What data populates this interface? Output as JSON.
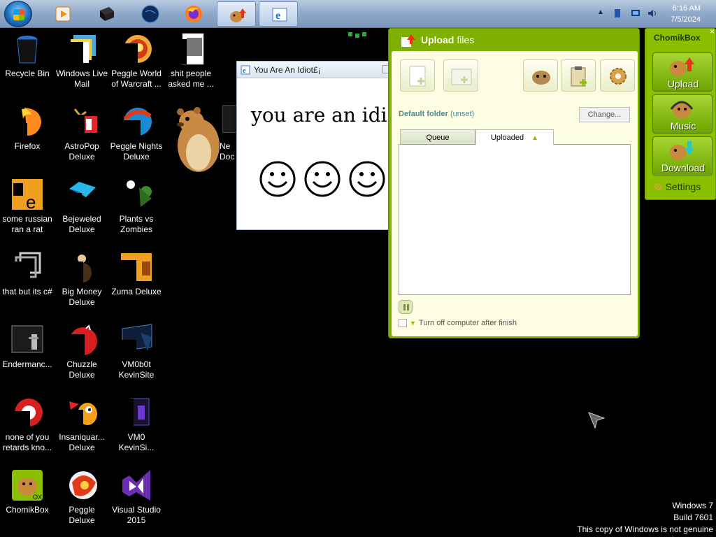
{
  "taskbar": {
    "start": "start-orb",
    "pinned": [
      "media-player-icon",
      "dark-app-icon",
      "globe-icon",
      "firefox-icon",
      "chomikbox-icon",
      "internet-explorer-icon"
    ],
    "clock": {
      "time": "6:16 AM",
      "date": "7/5/2024"
    }
  },
  "desktop_icons": [
    {
      "label": "Recycle Bin",
      "icon": "recycle-bin-icon"
    },
    {
      "label": "Windows Live Mail",
      "icon": "mail-icon"
    },
    {
      "label": "Peggle World of Warcraft ...",
      "icon": "peggle-icon"
    },
    {
      "label": "shit people asked me ...",
      "icon": "folder-icon"
    },
    {
      "label": "Firefox",
      "icon": "firefox-icon"
    },
    {
      "label": "AstroPop Deluxe",
      "icon": "astropop-icon"
    },
    {
      "label": "Peggle Nights Deluxe",
      "icon": "peggle-nights-icon"
    },
    {
      "label": "some russian ran a rat",
      "icon": "document-icon"
    },
    {
      "label": "Bejeweled Deluxe",
      "icon": "bejeweled-icon"
    },
    {
      "label": "Plants vs Zombies",
      "icon": "pvz-icon"
    },
    {
      "label": "that but its c#",
      "icon": "shortcut-icon"
    },
    {
      "label": "Big Money Deluxe",
      "icon": "big-money-icon"
    },
    {
      "label": "Zuma Deluxe",
      "icon": "zuma-icon"
    },
    {
      "label": "Endermanc...",
      "icon": "console-icon"
    },
    {
      "label": "Chuzzle Deluxe",
      "icon": "chuzzle-icon"
    },
    {
      "label": "VM0b0t KevinSite",
      "icon": "vm-icon"
    },
    {
      "label": "none of you retards kno...",
      "icon": "red-app-icon"
    },
    {
      "label": "Insaniquar... Deluxe",
      "icon": "insaniquarium-icon"
    },
    {
      "label": "VM0 KevinSi...",
      "icon": "vm-file-icon"
    },
    {
      "label": "ChomikBox",
      "icon": "chomikbox-app-icon"
    },
    {
      "label": "Peggle Deluxe",
      "icon": "peggle-deluxe-icon"
    },
    {
      "label": "Visual Studio 2015",
      "icon": "visual-studio-icon"
    }
  ],
  "partial_icon_label": "Ne\nDoc",
  "idiot_window": {
    "title": "You Are An Idiot£¡",
    "body_text": "you are an idiot",
    "smileys": [
      "☺",
      "☺",
      "☺"
    ]
  },
  "upload_panel": {
    "title_bold": "Upload",
    "title_rest": " files",
    "default_folder_label": "Default folder",
    "default_folder_value": "(unset)",
    "change_button": "Change...",
    "tabs": [
      "Queue",
      "Uploaded"
    ],
    "active_tab": "Uploaded",
    "turn_off_label": "Turn off computer after finish"
  },
  "chomikbox_menu": {
    "title": "ChomikBox",
    "buttons": [
      "Upload",
      "Music",
      "Download"
    ],
    "settings": "Settings"
  },
  "watermark": {
    "line1": "Windows 7",
    "line2": "Build 7601",
    "line3": "This copy of Windows is not genuine"
  },
  "colors": {
    "chomik_green": "#7fb000",
    "panel_bg": "#fdfde3",
    "taskbar": "#8ea8c8",
    "folder_label": "#4d8b91"
  }
}
